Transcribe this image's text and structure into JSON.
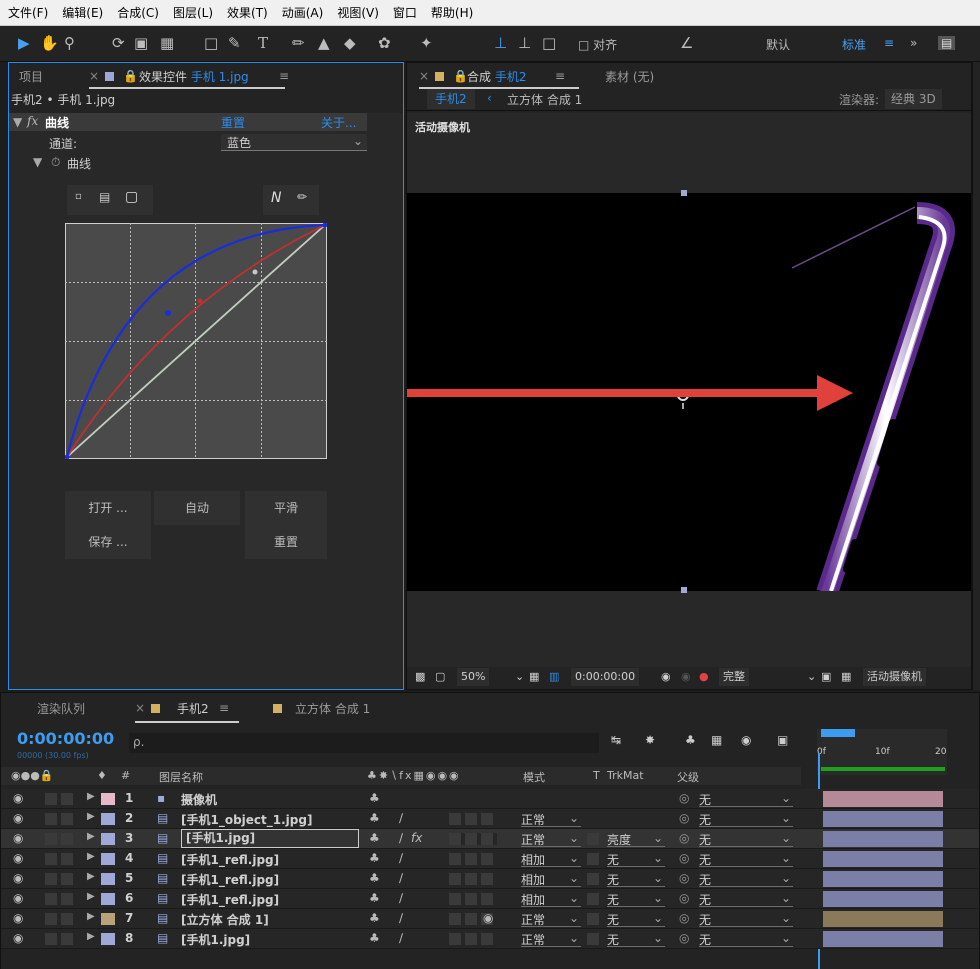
{
  "menu": [
    "文件(F)",
    "编辑(E)",
    "合成(C)",
    "图层(L)",
    "效果(T)",
    "动画(A)",
    "视图(V)",
    "窗口",
    "帮助(H)"
  ],
  "toolbar": {
    "align_label": "对齐",
    "default_label": "默认",
    "standard_label": "标准",
    "more_label": "»"
  },
  "left_panel": {
    "tab_project": "项目",
    "tab_effects_prefix": "效果控件",
    "tab_effects_file": "手机 1.jpg",
    "breadcrumb": "手机2 • 手机 1.jpg",
    "fx_label": "fx",
    "effect_name": "曲线",
    "reset_label": "重置",
    "about_label": "关于...",
    "channel_label": "通道:",
    "channel_value": "蓝色",
    "curve_label": "曲线",
    "buttons": {
      "open": "打开 ...",
      "auto": "自动",
      "smooth": "平滑",
      "save": "保存 ...",
      "reset": "重置"
    }
  },
  "comp_panel": {
    "tab_comp_prefix": "合成",
    "tab_comp_name": "手机2",
    "tab_footage": "素材 (无)",
    "crumb_active": "手机2",
    "crumb_next": "立方体 合成 1",
    "renderer_label": "渲染器:",
    "renderer_value": "经典 3D",
    "active_camera": "活动摄像机",
    "zoom": "50%",
    "timecode": "0:00:00:00",
    "quality": "完整",
    "view": "活动摄像机"
  },
  "timeline": {
    "tab_render": "渲染队列",
    "tab_comp": "手机2",
    "tab_other": "立方体 合成 1",
    "timecode": "0:00:00:00",
    "fps": "00000 (30.00 fps)",
    "search_placeholder": "ρ.",
    "header": {
      "hash": "#",
      "name": "图层名称",
      "mode": "模式",
      "t": "T",
      "trkmat": "TrkMat",
      "parent": "父级"
    },
    "ruler": [
      "0f",
      "10f",
      "20"
    ],
    "layers": [
      {
        "num": "1",
        "name": "摄像机",
        "mode": "",
        "trkmat": "",
        "parent": "无",
        "color": "#e6b8c8",
        "bar": "#b58a98"
      },
      {
        "num": "2",
        "name": "[手机1_object_1.jpg]",
        "mode": "正常",
        "trkmat": "",
        "parent": "无",
        "color": "#a0a8d8",
        "bar": "#7b7fa8"
      },
      {
        "num": "3",
        "name": "[手机1.jpg]",
        "mode": "正常",
        "trkmat": "亮度",
        "parent": "无",
        "color": "#a0a8d8",
        "bar": "#7b7fa8"
      },
      {
        "num": "4",
        "name": "[手机1_refl.jpg]",
        "mode": "相加",
        "trkmat": "无",
        "parent": "无",
        "color": "#a0a8d8",
        "bar": "#7b7fa8"
      },
      {
        "num": "5",
        "name": "[手机1_refl.jpg]",
        "mode": "相加",
        "trkmat": "无",
        "parent": "无",
        "color": "#a0a8d8",
        "bar": "#7b7fa8"
      },
      {
        "num": "6",
        "name": "[手机1_refl.jpg]",
        "mode": "相加",
        "trkmat": "无",
        "parent": "无",
        "color": "#a0a8d8",
        "bar": "#7b7fa8"
      },
      {
        "num": "7",
        "name": "[立方体 合成 1]",
        "mode": "正常",
        "trkmat": "无",
        "parent": "无",
        "color": "#b9a27a",
        "bar": "#8a7a5a"
      },
      {
        "num": "8",
        "name": "[手机1.jpg]",
        "mode": "正常",
        "trkmat": "无",
        "parent": "无",
        "color": "#a0a8d8",
        "bar": "#7b7fa8"
      }
    ]
  }
}
